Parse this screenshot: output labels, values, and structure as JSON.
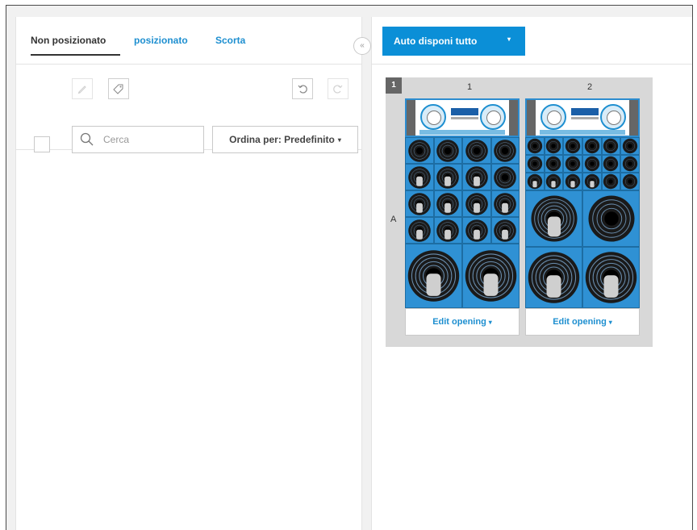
{
  "tabs": {
    "unpositioned": "Non posizionato",
    "positioned": "posizionato",
    "stock": "Scorta"
  },
  "collapse_icon": "«",
  "search": {
    "placeholder": "Cerca",
    "value": ""
  },
  "sort": {
    "label": "Ordina per: Predefinito",
    "caret": "▾"
  },
  "auto_button": {
    "label": "Auto disponi tutto",
    "caret": "▾"
  },
  "fixture": {
    "bay_number": "1",
    "columns": [
      "1",
      "2"
    ],
    "rows": [
      "A"
    ],
    "edit_label": "Edit opening",
    "edit_caret": "▾"
  },
  "colors": {
    "accent": "#0b8fd7",
    "bay_blue": "#2c8ccf",
    "fixture_bg": "#d8d8d8"
  },
  "icons": {
    "edit": "pencil-icon",
    "tag": "tag-icon",
    "undo": "undo-icon",
    "redo": "redo-icon",
    "search": "search-icon",
    "collapse": "double-chevron-left-icon"
  }
}
